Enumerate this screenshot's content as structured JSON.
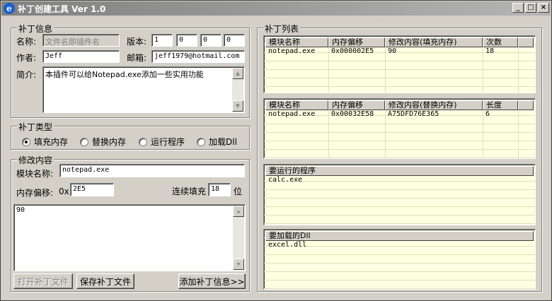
{
  "window": {
    "title": "补丁创建工具 Ver 1.0",
    "app_icon": "e-icon",
    "controls": {
      "minimize": "_",
      "maximize": "□",
      "close": "×"
    }
  },
  "patch_info": {
    "legend": "补丁信息",
    "name_label": "名称:",
    "name_placeholder": "文件名即插件名",
    "version_label": "版本:",
    "version": [
      "1",
      "0",
      "0",
      "0"
    ],
    "author_label": "作者:",
    "author": "Jeff",
    "email_label": "邮箱:",
    "email": "jeff1979@hotmail.com",
    "desc_label": "简介:",
    "desc": "本插件可以给Notepad.exe添加一些实用功能"
  },
  "patch_type": {
    "legend": "补丁类型",
    "options": [
      "填充内存",
      "替换内存",
      "运行程序",
      "加载Dll"
    ],
    "selected": 0
  },
  "modify": {
    "legend": "修改内容",
    "module_label": "模块名称:",
    "module": "notepad.exe",
    "offset_label": "内存偏移:",
    "offset_prefix": "0x",
    "offset": "2E5",
    "fill_label": "连续填充",
    "fill_count": "18",
    "fill_unit": "位",
    "content": "90"
  },
  "buttons": {
    "open": "打开补丁文件",
    "save": "保存补丁文件",
    "add": "添加补丁信息>>"
  },
  "patch_list": {
    "legend": "补丁列表",
    "fill_table": {
      "headers": [
        "模块名称",
        "内存偏移",
        "修改内容(填充内存)",
        "次数"
      ],
      "rows": [
        [
          "notepad.exe",
          "0x000002E5",
          "90",
          "18"
        ]
      ]
    },
    "replace_table": {
      "headers": [
        "模块名称",
        "内存偏移",
        "修改内容(替换内存)",
        "长度"
      ],
      "rows": [
        [
          "notepad.exe",
          "0x00032E58",
          "A75DFD76E365",
          "6"
        ]
      ]
    },
    "run_table": {
      "headers": [
        "要运行的程序"
      ],
      "rows": [
        [
          "calc.exe"
        ]
      ]
    },
    "dll_table": {
      "headers": [
        "要加载的Dll"
      ],
      "rows": [
        [
          "excel.dll"
        ]
      ]
    }
  }
}
